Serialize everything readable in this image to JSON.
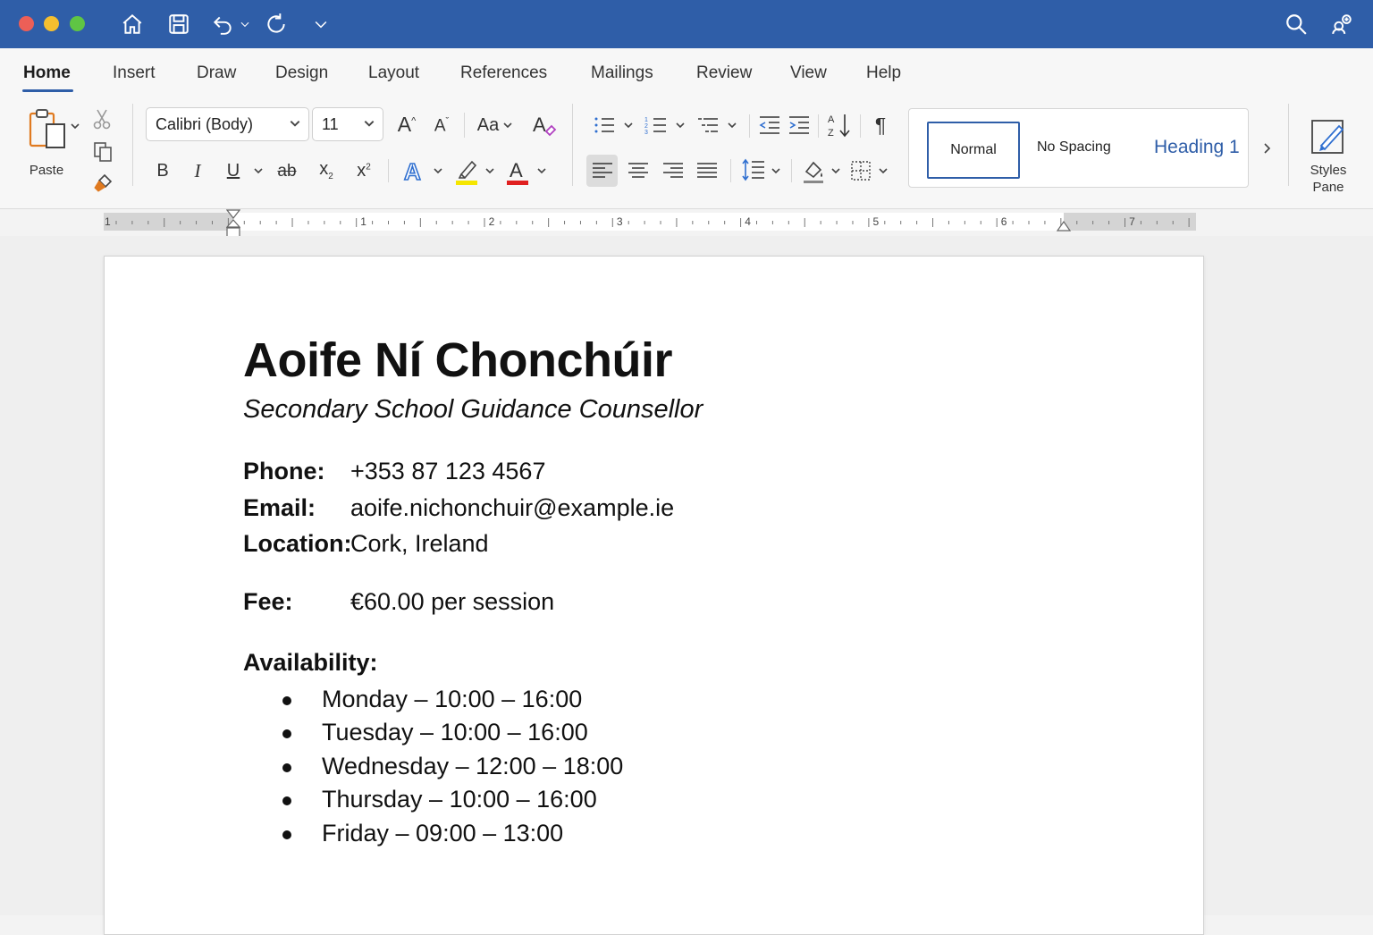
{
  "titlebar": {
    "icons": [
      "home-icon",
      "save-icon",
      "undo-icon",
      "redo-icon",
      "customize-icon",
      "search-icon",
      "share-icon"
    ]
  },
  "tabs": [
    "Home",
    "Insert",
    "Draw",
    "Design",
    "Layout",
    "References",
    "Mailings",
    "Review",
    "View",
    "Help"
  ],
  "active_tab": "Home",
  "ribbon": {
    "paste_label": "Paste",
    "font_name": "Calibri (Body)",
    "font_size": "11",
    "change_case_label": "Aa",
    "bold": "B",
    "italic": "I",
    "underline": "U",
    "strike": "ab",
    "subscript": "x",
    "superscript": "x",
    "styles": {
      "normal": "Normal",
      "no_spacing": "No Spacing",
      "heading1": "Heading 1"
    },
    "styles_pane_label": "Styles Pane",
    "pilcrow": "¶"
  },
  "ruler": {
    "numbers": [
      "1",
      "1",
      "2",
      "3",
      "4",
      "5",
      "6",
      "7"
    ]
  },
  "document": {
    "name": "Aoife Ní Chonchúir",
    "subtitle": "Secondary School Guidance Counsellor",
    "contact": [
      {
        "label": "Phone:",
        "value": "+353 87 123 4567"
      },
      {
        "label": "Email:",
        "value": "aoife.nichonchuir@example.ie"
      },
      {
        "label": "Location:",
        "value": "Cork, Ireland"
      }
    ],
    "fee": {
      "label": "Fee:",
      "value": "€60.00 per session"
    },
    "availability_heading": "Availability:",
    "availability": [
      "Monday – 10:00 – 16:00",
      "Tuesday – 10:00 – 16:00",
      "Wednesday – 12:00 – 18:00",
      "Thursday – 10:00 – 16:00",
      "Friday – 09:00 – 13:00"
    ]
  },
  "colors": {
    "titlebar": "#2f5ea8",
    "close": "#ec5f57",
    "minimize": "#f5bf2f",
    "zoom": "#5fc544",
    "accent": "#2f5ea8",
    "highlight": "#f5e600",
    "font_color": "#e02020"
  }
}
